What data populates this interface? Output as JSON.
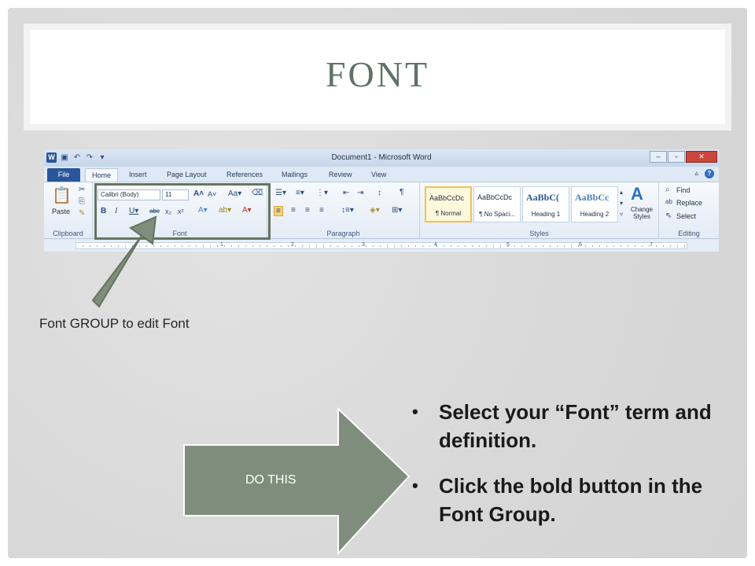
{
  "slide": {
    "title": "FONT",
    "caption": "Font GROUP to edit Font",
    "do_this": "DO THIS",
    "bullets": [
      "Select your “Font” term and definition.",
      "Click the bold button in the Font Group."
    ]
  },
  "word": {
    "window_title": "Document1 - Microsoft Word",
    "logo": "W",
    "tabs": [
      "File",
      "Home",
      "Insert",
      "Page Layout",
      "References",
      "Mailings",
      "Review",
      "View"
    ],
    "clipboard": {
      "paste": "Paste",
      "label": "Clipboard"
    },
    "font": {
      "name": "Calibri (Body)",
      "size": "11",
      "label": "Font"
    },
    "paragraph": {
      "label": "Paragraph"
    },
    "styles": {
      "label": "Styles",
      "items": [
        {
          "sample": "AaBbCcDc",
          "name": "¶ Normal"
        },
        {
          "sample": "AaBbCcDc",
          "name": "¶ No Spaci..."
        },
        {
          "sample": "AaBbC(",
          "name": "Heading 1"
        },
        {
          "sample": "AaBbCc",
          "name": "Heading 2"
        }
      ],
      "change": "Change Styles"
    },
    "editing": {
      "label": "Editing",
      "find": "Find",
      "replace": "Replace",
      "select": "Select"
    },
    "ruler": [
      "1",
      "2",
      "3",
      "4",
      "5",
      "6",
      "7"
    ]
  },
  "colors": {
    "title": "#5f7266",
    "arrow": "#7f8e7c",
    "highlight": "#64745f"
  }
}
